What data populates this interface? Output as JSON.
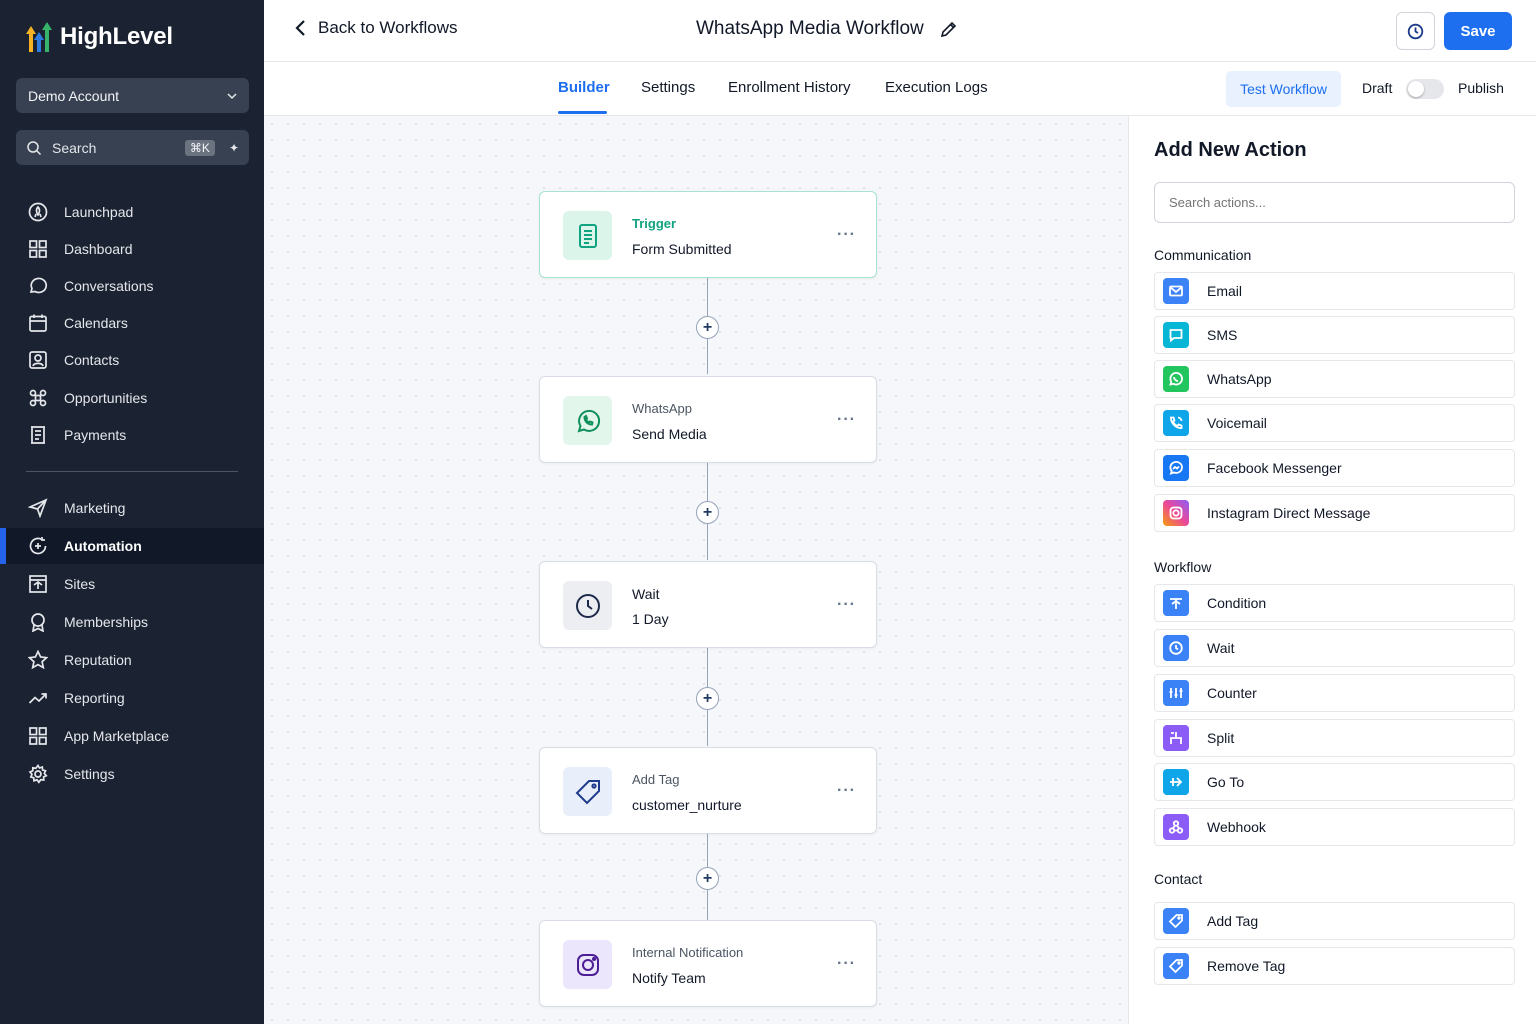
{
  "app": {
    "brand": "HighLevel",
    "account": "Demo Account"
  },
  "sidebar": {
    "search_label": "Search",
    "search_shortcut": "⌘K",
    "items": [
      {
        "label": "Launchpad",
        "icon": "rocket-icon"
      },
      {
        "label": "Dashboard",
        "icon": "grid-icon"
      },
      {
        "label": "Conversations",
        "icon": "chat-icon"
      },
      {
        "label": "Calendars",
        "icon": "calendar-icon"
      },
      {
        "label": "Contacts",
        "icon": "contacts-icon"
      },
      {
        "label": "Opportunities",
        "icon": "opportunities-icon"
      },
      {
        "label": "Payments",
        "icon": "receipt-icon"
      },
      {
        "label": "Marketing",
        "icon": "send-icon"
      },
      {
        "label": "Automation",
        "icon": "automation-icon",
        "active": true
      },
      {
        "label": "Sites",
        "icon": "sites-icon"
      },
      {
        "label": "Memberships",
        "icon": "badge-icon"
      },
      {
        "label": "Reputation",
        "icon": "star-icon"
      },
      {
        "label": "Reporting",
        "icon": "trend-icon"
      },
      {
        "label": "App Marketplace",
        "icon": "apps-icon"
      },
      {
        "label": "Settings",
        "icon": "gear-icon"
      }
    ]
  },
  "header": {
    "back_label": "Back to Workflows",
    "title": "WhatsApp Media Workflow",
    "save_label": "Save"
  },
  "tabs": [
    {
      "label": "Builder",
      "active": true
    },
    {
      "label": "Settings"
    },
    {
      "label": "Enrollment History"
    },
    {
      "label": "Execution Logs"
    }
  ],
  "toolbar": {
    "test_label": "Test Workflow",
    "draft_label": "Draft",
    "publish_label": "Publish",
    "published": false
  },
  "nodes": [
    {
      "type": "Trigger",
      "label": "Form Submitted",
      "icon": "form-icon"
    },
    {
      "type": "WhatsApp",
      "label": "Send Media",
      "icon": "whatsapp-icon"
    },
    {
      "type": "Wait",
      "label": "1 Day",
      "icon": "clock-icon"
    },
    {
      "type": "Add Tag",
      "label": "customer_nurture",
      "icon": "tag-icon"
    },
    {
      "type": "Internal Notification",
      "label": "Notify Team",
      "icon": "instagram-icon"
    }
  ],
  "panel": {
    "title": "Add New Action",
    "search_placeholder": "Search actions...",
    "sections": [
      {
        "title": "Communication",
        "actions": [
          "Email",
          "SMS",
          "WhatsApp",
          "Voicemail",
          "Facebook Messenger",
          "Instagram Direct Message"
        ]
      },
      {
        "title": "Workflow",
        "actions": [
          "Condition",
          "Wait",
          "Counter",
          "Split",
          "Go To",
          "Webhook"
        ]
      },
      {
        "title": "Contact",
        "actions": [
          "Add Tag",
          "Remove Tag"
        ]
      }
    ]
  },
  "colors": {
    "accent": "#1e6ff0",
    "sidebar_bg": "#1b2333",
    "trigger_green": "#10a37f"
  }
}
